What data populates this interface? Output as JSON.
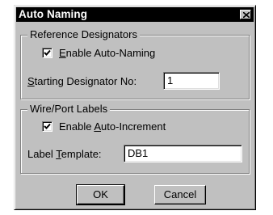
{
  "window": {
    "title": "Auto Naming"
  },
  "reference_group": {
    "label": "Reference Designators",
    "enable_checkbox": {
      "checked": true,
      "mnemonic": "E",
      "rest": "nable Auto-Naming"
    },
    "start_field": {
      "mnemonic": "S",
      "rest": "tarting Designator No:",
      "value": "1"
    }
  },
  "wire_group": {
    "label": "Wire/Port Labels",
    "increment_checkbox": {
      "checked": true,
      "pre": "Enable ",
      "mnemonic": "A",
      "rest": "uto-Increment"
    },
    "template_field": {
      "pre": "Label ",
      "mnemonic": "T",
      "rest": "emplate:",
      "value": "DB1"
    }
  },
  "buttons": {
    "ok": "OK",
    "cancel": "Cancel"
  },
  "icons": {
    "close": "close-icon",
    "check": "checkmark-icon"
  }
}
